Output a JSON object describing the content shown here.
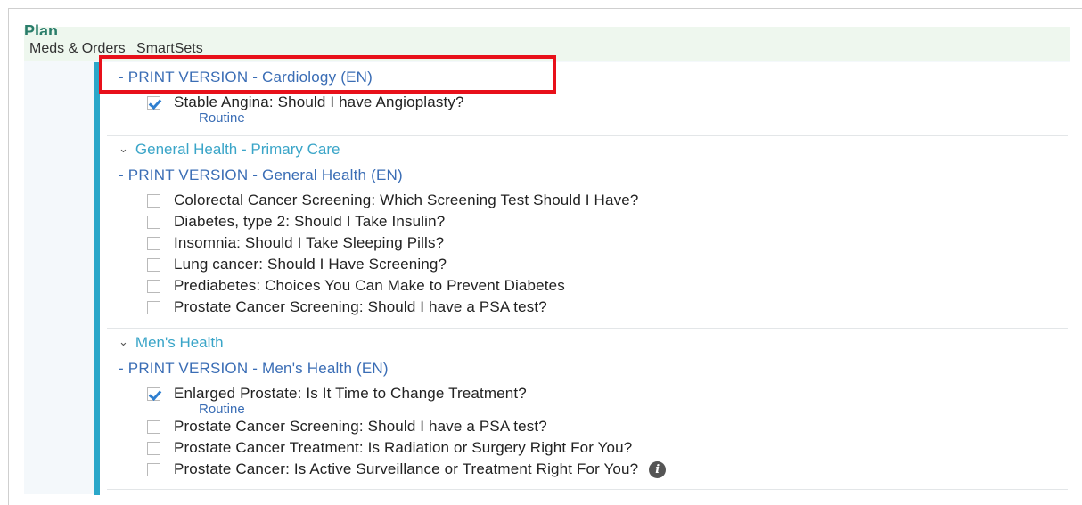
{
  "plan": {
    "title": "Plan"
  },
  "tabs": [
    "Meds & Orders",
    "SmartSets"
  ],
  "sections": {
    "cardiology": {
      "header": "- PRINT VERSION - Cardiology (EN)",
      "items": [
        {
          "label": "Stable Angina: Should I have Angioplasty?",
          "checked": true,
          "sub": "Routine"
        }
      ]
    },
    "general": {
      "group": "General Health - Primary Care",
      "header": "- PRINT VERSION - General Health (EN)",
      "items": [
        {
          "label": "Colorectal Cancer Screening:  Which Screening Test Should I Have?",
          "checked": false
        },
        {
          "label": "Diabetes, type 2: Should I Take Insulin?",
          "checked": false
        },
        {
          "label": "Insomnia: Should I Take Sleeping Pills?",
          "checked": false
        },
        {
          "label": "Lung cancer: Should I Have Screening?",
          "checked": false
        },
        {
          "label": "Prediabetes: Choices You Can Make to Prevent Diabetes",
          "checked": false
        },
        {
          "label": "Prostate Cancer Screening: Should I have a PSA test?",
          "checked": false
        }
      ]
    },
    "mens": {
      "group": "Men's Health",
      "header": "- PRINT VERSION - Men's Health (EN)",
      "items": [
        {
          "label": "Enlarged Prostate: Is It Time to Change Treatment?",
          "checked": true,
          "sub": "Routine"
        },
        {
          "label": "Prostate Cancer Screening: Should I have a PSA test?",
          "checked": false
        },
        {
          "label": "Prostate Cancer Treatment: Is Radiation or Surgery Right For You?",
          "checked": false
        },
        {
          "label": "Prostate Cancer: Is Active Surveillance or Treatment Right For You?",
          "checked": false,
          "info": true
        }
      ]
    }
  },
  "icons": {
    "check": "checkmark-icon",
    "info": "info-icon",
    "chevron": "chevron-down-icon"
  },
  "colors": {
    "accent": "#2aa7c9",
    "link": "#3a6db5",
    "group": "#3aa5c8",
    "highlight": "#e8101a"
  }
}
